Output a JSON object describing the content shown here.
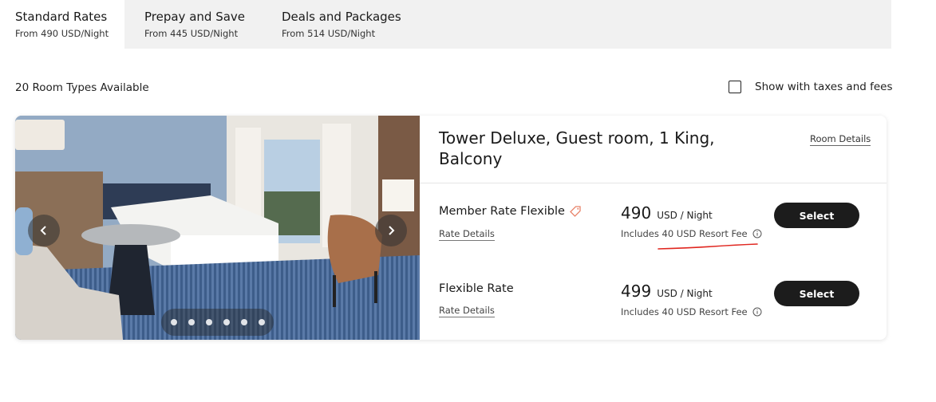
{
  "tabs": [
    {
      "label": "Standard Rates",
      "sub": "From 490 USD/Night",
      "active": true
    },
    {
      "label": "Prepay and Save",
      "sub": "From 445 USD/Night",
      "active": false
    },
    {
      "label": "Deals and Packages",
      "sub": "From 514 USD/Night",
      "active": false
    }
  ],
  "list": {
    "room_count": "20 Room Types Available",
    "tax_toggle_label": "Show with taxes and fees",
    "tax_toggle_checked": false
  },
  "room": {
    "title": "Tower Deluxe, Guest room, 1 King, Balcony",
    "details_link": "Room Details",
    "carousel": {
      "dot_count": 6
    },
    "rates": [
      {
        "name": "Member Rate Flexible",
        "icon": "tag-icon",
        "details_link": "Rate Details",
        "price": "490",
        "unit": "USD / Night",
        "fee_note": "Includes 40 USD Resort Fee",
        "button": "Select"
      },
      {
        "name": "Flexible Rate",
        "details_link": "Rate Details",
        "price": "499",
        "unit": "USD / Night",
        "fee_note": "Includes 40 USD Resort Fee",
        "button": "Select"
      }
    ]
  },
  "colors": {
    "tab_bar": "#f1f1f1",
    "button": "#1c1c1c",
    "tag_accent": "#e8836a",
    "annotation": "#e0261f"
  }
}
